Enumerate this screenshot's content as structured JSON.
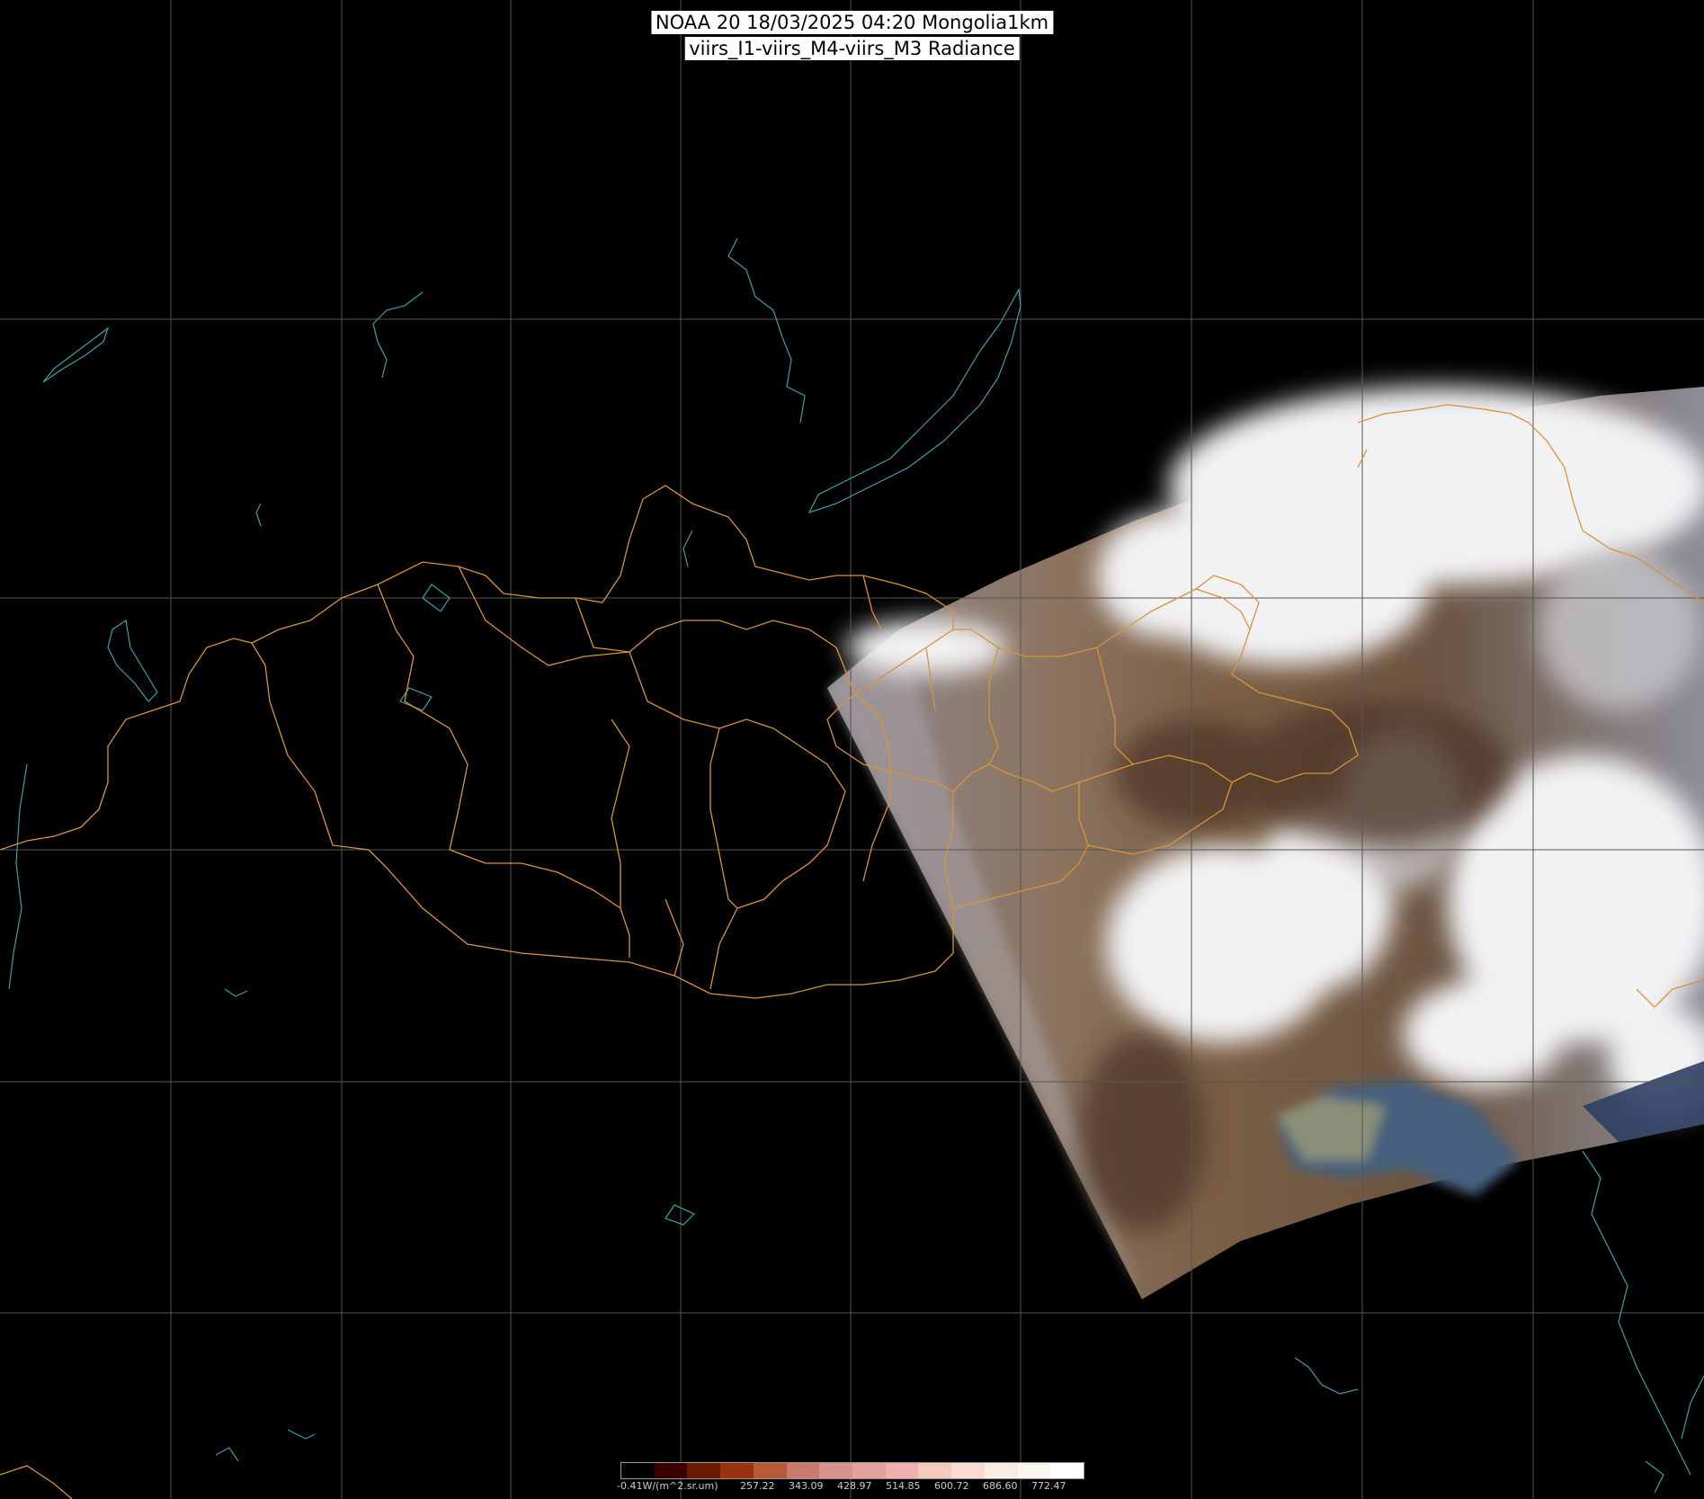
{
  "title": {
    "line1": "NOAA 20 18/03/2025 04:20 Mongolia1km",
    "line2": "viirs_I1-viirs_M4-viirs_M3 Radiance"
  },
  "colorbar": {
    "unit_label": "-0.41W/(m^2.sr.um)",
    "tick_labels": [
      "257.22",
      "343.09",
      "428.97",
      "514.85",
      "600.72",
      "686.60",
      "772.47"
    ],
    "colors": [
      "#000000",
      "#3a0000",
      "#6b1a00",
      "#99330d",
      "#b85a3a",
      "#c97a6a",
      "#d99090",
      "#e6a0a0",
      "#f0b0b0",
      "#f5c8c0",
      "#f8dcd0",
      "#fbece2",
      "#fdf6ee",
      "#ffffff"
    ]
  },
  "colors": {
    "grid": "#555555",
    "borders": "#d9933a",
    "coast": "#3aa0a8"
  }
}
